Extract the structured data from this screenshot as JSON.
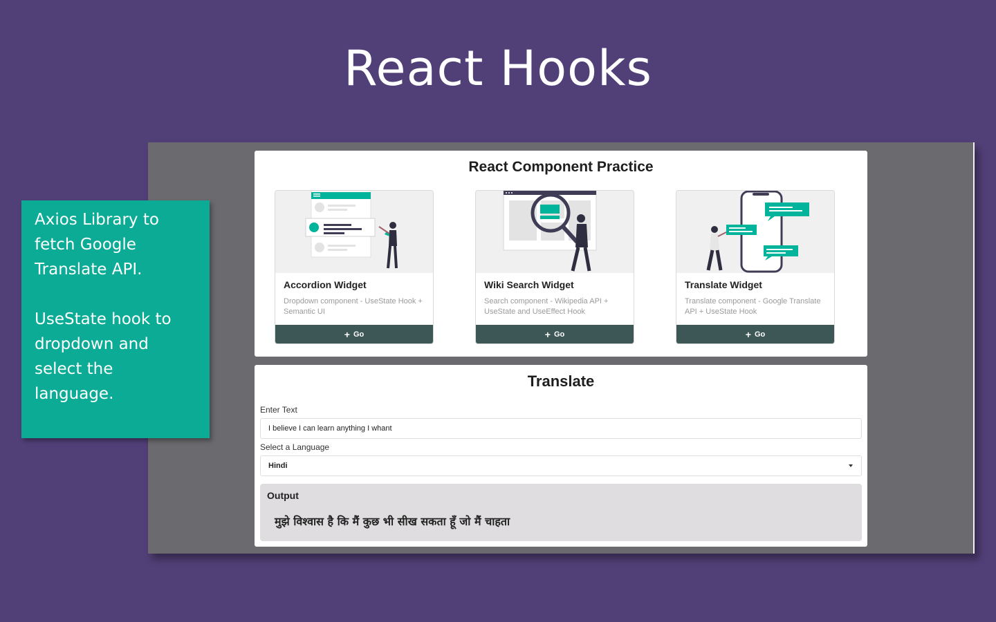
{
  "slide": {
    "title": "React Hooks",
    "notes": [
      "Axios Library to fetch Google Translate API.",
      "UseState hook to dropdown and select the language."
    ]
  },
  "app": {
    "practice": {
      "heading": "React Component Practice",
      "cards": [
        {
          "title": "Accordion Widget",
          "description": "Dropdown component - UseState Hook + Semantic UI",
          "button_label": "Go",
          "illustration": "accordion-illustration"
        },
        {
          "title": "Wiki Search Widget",
          "description": "Search component - Wikipedia API + UseState and UseEffect Hook",
          "button_label": "Go",
          "illustration": "wiki-search-illustration"
        },
        {
          "title": "Translate Widget",
          "description": "Translate component - Google Translate API + UseState Hook",
          "button_label": "Go",
          "illustration": "translate-illustration"
        }
      ]
    },
    "translate": {
      "heading": "Translate",
      "text_label": "Enter Text",
      "text_value": "I believe I can learn anything I whant",
      "language_label": "Select a Language",
      "language_value": "Hindi",
      "output_label": "Output",
      "output_text": "मुझे विश्वास है कि मैं कुछ भी सीख सकता हूँ जो मैं चाहता"
    }
  },
  "colors": {
    "background": "#513f77",
    "note_box": "#0bab96",
    "accent": "#00b39b",
    "button": "#3d5756",
    "output_bg": "#dfdddf"
  }
}
